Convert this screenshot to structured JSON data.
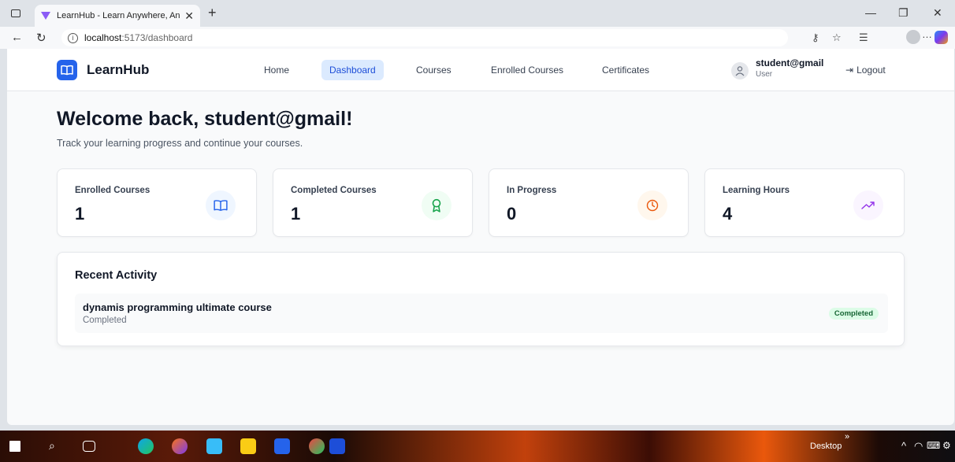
{
  "browser": {
    "tab_title": "LearnHub - Learn Anywhere, Anyt",
    "url_host": "localhost",
    "url_path": ":5173/dashboard"
  },
  "nav": {
    "brand": "LearnHub",
    "links": [
      {
        "label": "Home",
        "active": false
      },
      {
        "label": "Dashboard",
        "active": true
      },
      {
        "label": "Courses",
        "active": false
      },
      {
        "label": "Enrolled Courses",
        "active": false
      },
      {
        "label": "Certificates",
        "active": false
      }
    ],
    "user_name": "student@gmail",
    "user_role": "User",
    "logout_label": "Logout"
  },
  "header": {
    "title": "Welcome back, student@gmail!",
    "subtitle": "Track your learning progress and continue your courses."
  },
  "stats": [
    {
      "label": "Enrolled Courses",
      "value": "1",
      "icon": "book-icon",
      "icon_color": "#2563eb",
      "icon_bg": "#eff6ff"
    },
    {
      "label": "Completed Courses",
      "value": "1",
      "icon": "award-icon",
      "icon_color": "#16a34a",
      "icon_bg": "#f0fdf4"
    },
    {
      "label": "In Progress",
      "value": "0",
      "icon": "clock-icon",
      "icon_color": "#ea580c",
      "icon_bg": "#fff7ed"
    },
    {
      "label": "Learning Hours",
      "value": "4",
      "icon": "trending-up-icon",
      "icon_color": "#9333ea",
      "icon_bg": "#faf5ff"
    }
  ],
  "activity": {
    "title": "Recent Activity",
    "items": [
      {
        "course": "dynamis programming ultimate course",
        "status": "Completed",
        "badge": "Completed"
      }
    ]
  },
  "taskbar": {
    "desktop_label": "Desktop"
  },
  "colors": {
    "accent": "#2563eb",
    "active_nav_bg": "#dbeafe",
    "badge_bg": "#dcfce7",
    "badge_text": "#166534"
  }
}
